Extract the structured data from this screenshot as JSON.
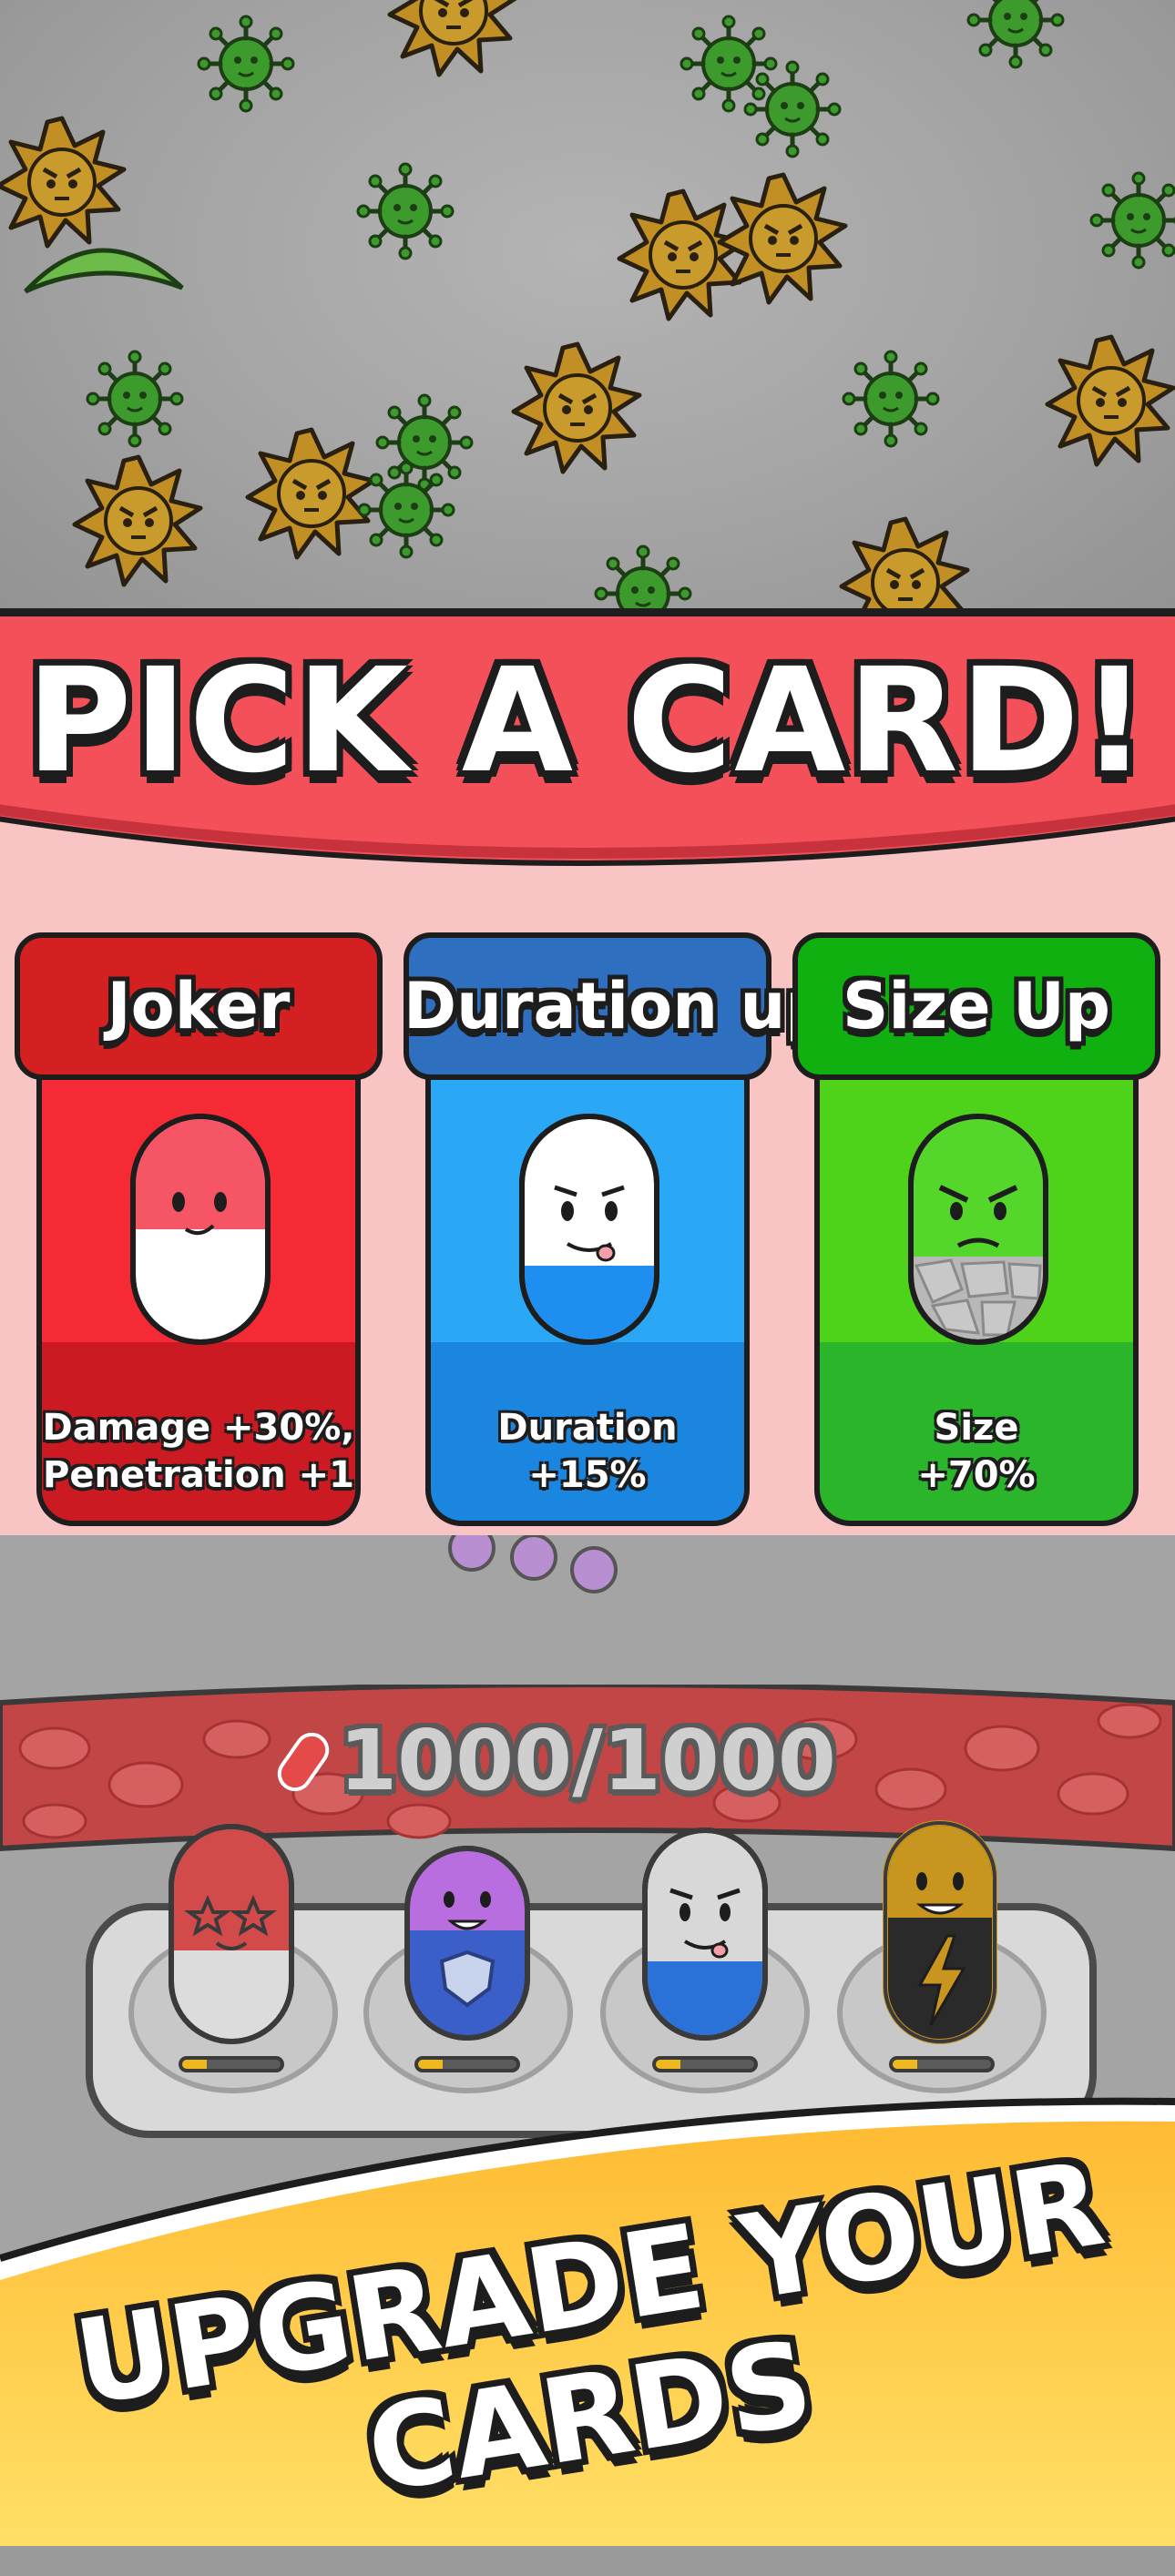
{
  "banner": {
    "title": "PICK A CARD!"
  },
  "cards": [
    {
      "title": "Joker",
      "desc_line1": "Damage +30%,",
      "desc_line2": "Penetration +1",
      "header_color": "#d42020",
      "body_top": "#f52a34",
      "body_bottom": "#cc1a22",
      "pill_icon": "joker-pill-icon"
    },
    {
      "title": "Duration up",
      "desc_line1": "Duration",
      "desc_line2": "+15%",
      "header_color": "#2f6fc0",
      "body_top": "#2ba8f5",
      "body_bottom": "#1a86e0",
      "pill_icon": "duration-pill-icon"
    },
    {
      "title": "Size Up",
      "desc_line1": "Size",
      "desc_line2": "+70%",
      "header_color": "#10b010",
      "body_top": "#4fd31a",
      "body_bottom": "#2bb52b",
      "pill_icon": "size-pill-icon"
    }
  ],
  "hud": {
    "hp_text": "1000/1000"
  },
  "loadout": [
    {
      "name": "star-eyes-pill",
      "charge": 0.25
    },
    {
      "name": "shield-pill",
      "charge": 0.25
    },
    {
      "name": "silver-pill",
      "charge": 0.25
    },
    {
      "name": "lightning-pill",
      "charge": 0.25
    }
  ],
  "promo": {
    "line1": "UPGRADE YOUR",
    "line2": "CARDS"
  },
  "colors": {
    "banner_red": "#f3505a",
    "banner_bg": "#f8c4c4",
    "promo_yellow": "#ffcc33",
    "virus_green": "#3a9a2a",
    "virus_orange": "#c89222"
  }
}
